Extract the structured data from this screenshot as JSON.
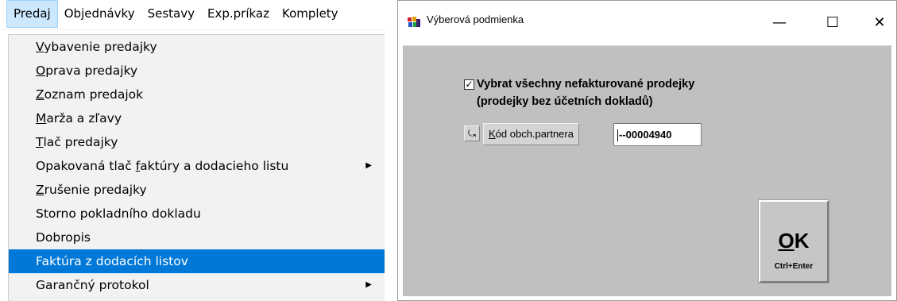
{
  "menubar": {
    "items": [
      {
        "label": "Predaj"
      },
      {
        "label": "Objednávky"
      },
      {
        "label": "Sestavy"
      },
      {
        "label": "Exp.príkaz"
      },
      {
        "label": "Komplety"
      }
    ]
  },
  "dropdown": {
    "items": [
      {
        "u": "V",
        "rest": "ybavenie predajky",
        "submenu": false
      },
      {
        "u": "O",
        "rest": "prava predajky",
        "submenu": false
      },
      {
        "u": "Z",
        "rest": "oznam predajok",
        "submenu": false
      },
      {
        "u": "M",
        "rest": "arža a zľavy",
        "submenu": false
      },
      {
        "u": "T",
        "rest": "lač predajky",
        "submenu": false
      },
      {
        "pre": "Opakovaná tlač ",
        "u": "f",
        "rest": "aktúry a dodacieho listu",
        "submenu": true
      },
      {
        "u": "Z",
        "rest": "rušenie predajky",
        "submenu": false
      },
      {
        "label": "Storno pokladního dokladu",
        "submenu": false
      },
      {
        "label": "Dobropis",
        "submenu": false
      },
      {
        "label": "Faktúra z dodacích listov",
        "submenu": false,
        "highlighted": true
      },
      {
        "label": "Garančný protokol",
        "submenu": true
      }
    ]
  },
  "dialog": {
    "title": "Výberová podmienka",
    "minimize": "—",
    "maximize": "☐",
    "close": "✕",
    "checkbox": {
      "checked": true,
      "mark": "✓",
      "line1": "Vybrat všechny nefakturované prodejky",
      "line2": "(prodejky bez účetních dokladů)"
    },
    "swap_icon": "⤿",
    "partner_label_u": "K",
    "partner_label_rest": "ód  obch.partnera",
    "partner_value": "--00004940",
    "ok": {
      "u": "O",
      "rest": "K",
      "shortcut": "Ctrl+Enter"
    }
  },
  "colors": {
    "highlight": "#0078d7",
    "client_bg": "#c0c0c0",
    "menubar_active": "#cce8ff"
  }
}
